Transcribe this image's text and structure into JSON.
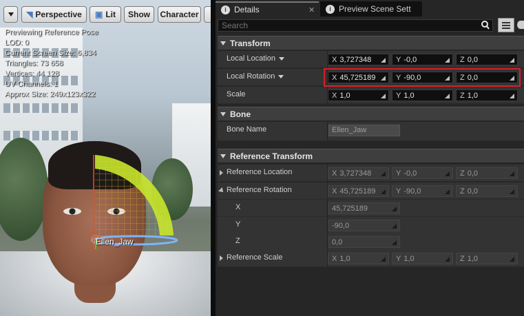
{
  "viewport": {
    "toolbar": {
      "perspective_label": "Perspective",
      "lit_label": "Lit",
      "show_label": "Show",
      "character_label": "Character"
    },
    "overlay_lines": [
      "Previewing Reference Pose",
      "LOD: 0",
      "Current Screen Size: 6,834",
      "Triangles: 73 658",
      "Vertices: 44 128",
      "UV Channels: 1",
      "Approx Size: 249x123x322"
    ],
    "bone_label": "Ellen_Jaw",
    "colors": {
      "gizmo_arc": "#c8e62c",
      "bone_line": "#e8501e",
      "gizmo_ring": "#7fb3ff"
    }
  },
  "tabs": [
    {
      "label": "Details",
      "icon": "info-icon",
      "active": true
    },
    {
      "label": "Preview Scene Sett",
      "icon": "info-icon",
      "active": false
    }
  ],
  "search": {
    "placeholder": "Search",
    "value": ""
  },
  "transform": {
    "header": "Transform",
    "location": {
      "label": "Local Location",
      "x": "3,727348",
      "y": "-0,0",
      "z": "0,0"
    },
    "rotation": {
      "label": "Local Rotation",
      "x": "45,725189",
      "y": "-90,0",
      "z": "0,0"
    },
    "scale": {
      "label": "Scale",
      "x": "1,0",
      "y": "1,0",
      "z": "1,0"
    }
  },
  "bone": {
    "header": "Bone",
    "name_label": "Bone Name",
    "name_value": "Ellen_Jaw"
  },
  "reference": {
    "header": "Reference Transform",
    "location": {
      "label": "Reference Location",
      "x": "3,727348",
      "y": "-0,0",
      "z": "0,0"
    },
    "rotation": {
      "label": "Reference Rotation",
      "x": "45,725189",
      "y": "-90,0",
      "z": "0,0"
    },
    "x": {
      "label": "X",
      "value": "45,725189"
    },
    "y": {
      "label": "Y",
      "value": "-90,0"
    },
    "z": {
      "label": "Z",
      "value": "0,0"
    },
    "scale": {
      "label": "Reference Scale",
      "x": "1,0",
      "y": "1,0",
      "z": "1,0"
    }
  },
  "axis_letters": {
    "x": "X",
    "y": "Y",
    "z": "Z"
  },
  "highlight_color": "#d8202a"
}
